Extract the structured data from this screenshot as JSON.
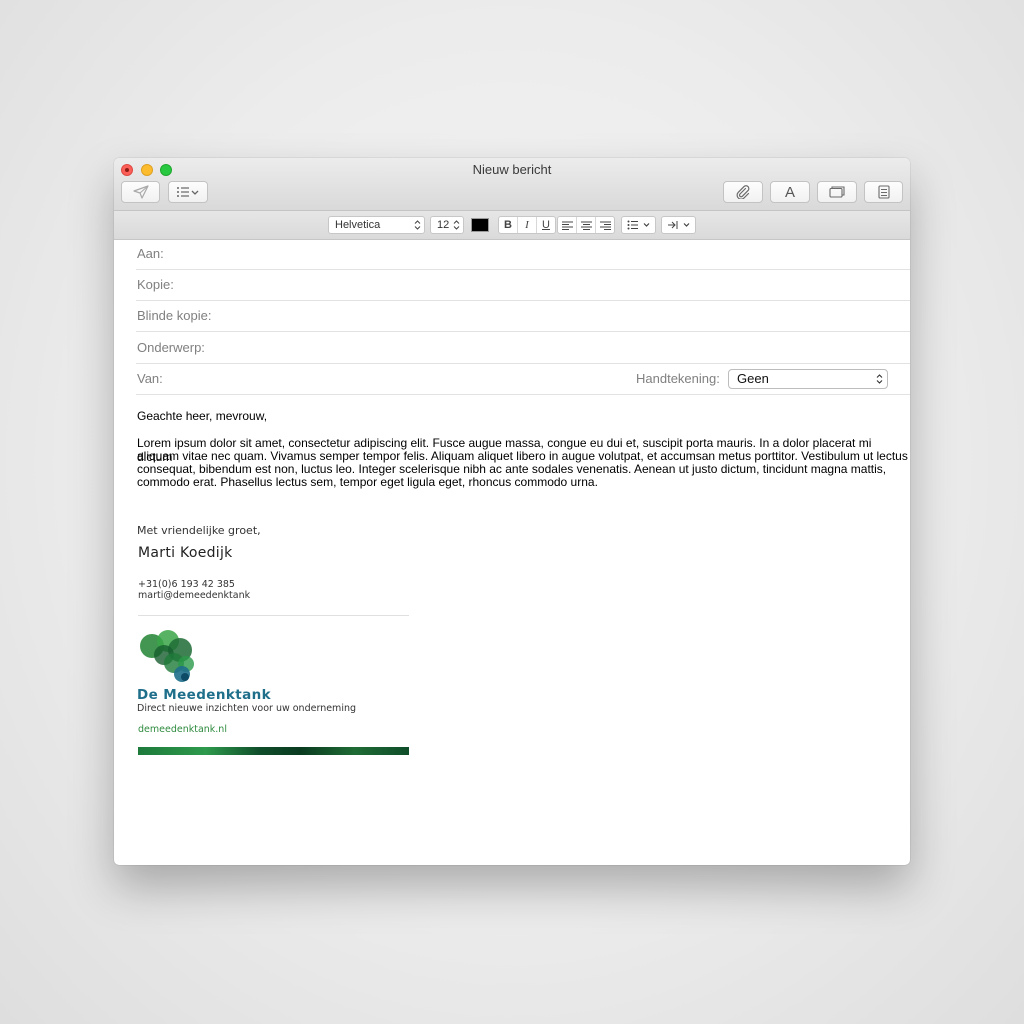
{
  "window": {
    "title": "Nieuw bericht"
  },
  "toolbar": {
    "send_icon": "paper-plane-icon",
    "header_fields_icon": "list-icon",
    "attach_icon": "paperclip-icon",
    "fonts_label": "A",
    "browser_icon": "photo-browser-icon",
    "stationery_icon": "stationery-icon"
  },
  "format_bar": {
    "font": "Helvetica",
    "size": "12",
    "color": "#000000",
    "bold": "B",
    "italic": "I",
    "underline": "U"
  },
  "fields": {
    "to_label": "Aan:",
    "cc_label": "Kopie:",
    "bcc_label": "Blinde kopie:",
    "subject_label": "Onderwerp:",
    "from_label": "Van:",
    "signature_label": "Handtekening:",
    "signature_value": "Geen"
  },
  "message": {
    "greeting": "Geachte heer, mevrouw,",
    "paragraph_lines": [
      "Lorem ipsum dolor sit amet, consectetur adipiscing elit. Fusce augue massa, congue eu dui et, suscipit porta mauris. In a dolor placerat mi dictum",
      "aliquam vitae nec quam. Vivamus semper tempor felis. Aliquam aliquet libero in augue volutpat, et accumsan metus porttitor. Vestibulum ut lectus",
      "consequat, bibendum est non, luctus leo. Integer scelerisque nibh ac ante sodales venenatis. Aenean ut justo dictum, tincidunt magna mattis,",
      "commodo erat. Phasellus lectus sem, tempor eget ligula eget, rhoncus commodo urna."
    ]
  },
  "signature": {
    "closing": "Met vriendelijke groet,",
    "name": "Marti Koedijk",
    "phone": "+31(0)6 193 42 385",
    "email": "marti@demeedenktank",
    "company": "De Meedenktank",
    "tagline": "Direct nieuwe inzichten voor uw onderneming",
    "website": "demeedenktank.nl",
    "colors": {
      "brand_blue": "#1f6f8b",
      "brand_green": "#2e8b3e",
      "dark_green": "#0f4d2a"
    }
  }
}
